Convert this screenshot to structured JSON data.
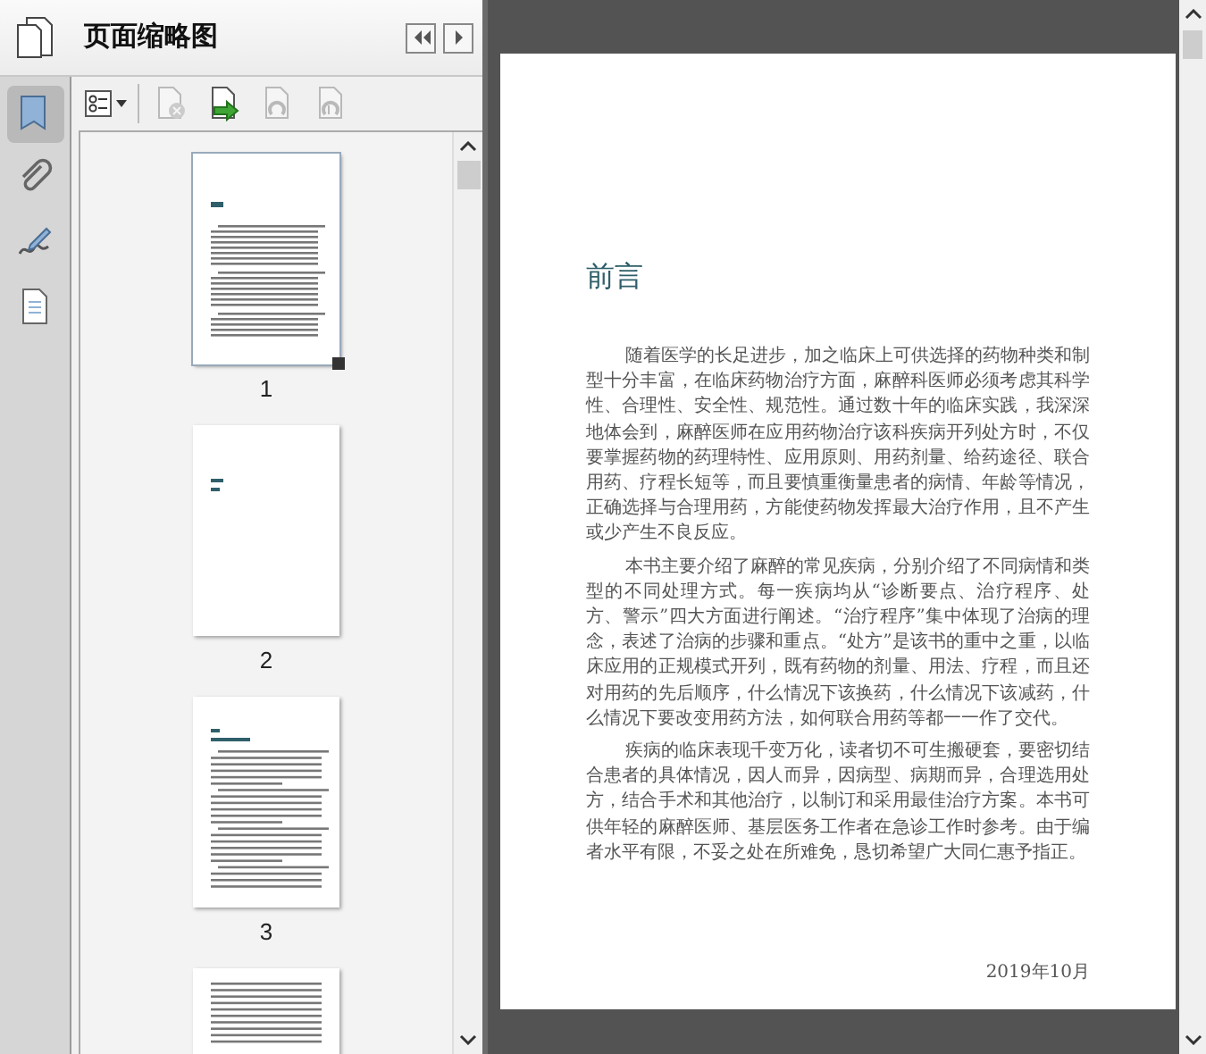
{
  "panel": {
    "title": "页面缩略图"
  },
  "side_tools": [
    {
      "kind": "bookmark",
      "selected": true
    },
    {
      "kind": "attachment",
      "selected": false
    },
    {
      "kind": "signature",
      "selected": false
    },
    {
      "kind": "document",
      "selected": false
    }
  ],
  "toolbar": [
    {
      "kind": "options",
      "disabled": false
    },
    {
      "kind": "delete",
      "disabled": true
    },
    {
      "kind": "insert",
      "disabled": false
    },
    {
      "kind": "undo",
      "disabled": true
    },
    {
      "kind": "redo",
      "disabled": true
    }
  ],
  "thumbnails": [
    {
      "label": "1",
      "kind": "preface",
      "selected": true
    },
    {
      "label": "2",
      "kind": "chapter",
      "selected": false
    },
    {
      "label": "3",
      "kind": "text",
      "selected": false
    },
    {
      "kind": "full",
      "selected": false
    }
  ],
  "document": {
    "heading": "前言",
    "paragraphs": [
      "随着医学的长足进步，加之临床上可供选择的药物种类和制型十分丰富，在临床药物治疗方面，麻醉科医师必须考虑其科学性、合理性、安全性、规范性。通过数十年的临床实践，我深深地体会到，麻醉医师在应用药物治疗该科疾病开列处方时，不仅要掌握药物的药理特性、应用原则、用药剂量、给药途径、联合用药、疗程长短等，而且要慎重衡量患者的病情、年龄等情况，正确选择与合理用药，方能使药物发挥最大治疗作用，且不产生或少产生不良反应。",
      "本书主要介绍了麻醉的常见疾病，分别介绍了不同病情和类型的不同处理方式。每一疾病均从“诊断要点、治疗程序、处方、警示”四大方面进行阐述。“治疗程序”集中体现了治病的理念，表述了治病的步骤和重点。“处方”是该书的重中之重，以临床应用的正规模式开列，既有药物的剂量、用法、疗程，而且还对用药的先后顺序，什么情况下该换药，什么情况下该减药，什么情况下要改变用药方法，如何联合用药等都一一作了交代。",
      "疾病的临床表现千变万化，读者切不可生搬硬套，要密切结合患者的具体情况，因人而异，因病型、病期而异，合理选用处方，结合手术和其他治疗，以制订和采用最佳治疗方案。本书可供年轻的麻醉医师、基层医务工作者在急诊工作时参考。由于编者水平有限，不妥之处在所难免，恳切希望广大同仁惠予指正。"
    ],
    "date": "2019年10月"
  }
}
